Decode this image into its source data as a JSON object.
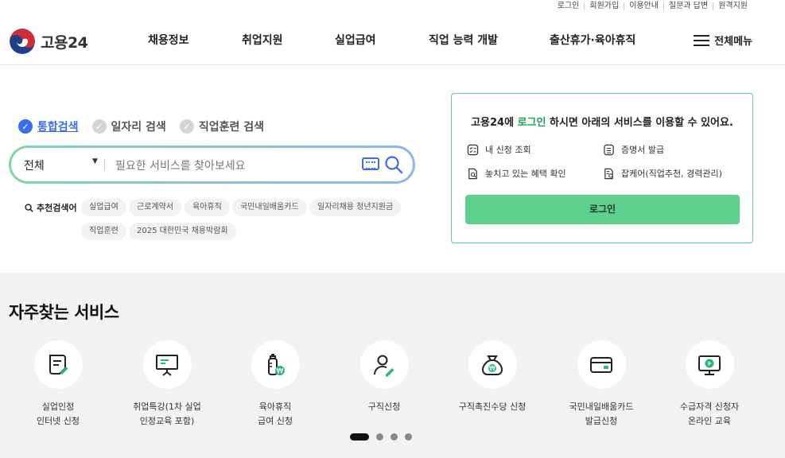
{
  "util_links": [
    "로그인",
    "회원가입",
    "이용안내",
    "질문과 답변",
    "원격지원"
  ],
  "logo": {
    "text": "고용24"
  },
  "nav": [
    "채용정보",
    "취업지원",
    "실업급여",
    "직업 능력 개발",
    "출산휴가·육아휴직"
  ],
  "all_menu": "전체메뉴",
  "search": {
    "tabs": [
      "통합검색",
      "일자리 검색",
      "직업훈련 검색"
    ],
    "active_tab": 0,
    "category": "전체",
    "placeholder": "필요한 서비스를 찾아보세요",
    "recommend_label": "추천검색어",
    "chips": [
      "실업급여",
      "근로계약서",
      "육아휴직",
      "국민내일배움카드",
      "일자리채용 청년지원금",
      "직업훈련",
      "2025 대한민국 채용박람회"
    ]
  },
  "login_box": {
    "title_pre": "고용24에",
    "title_link": "로그인",
    "title_post": "하시면 아래의 서비스를 이용할 수 있어요.",
    "services": [
      "내 신청 조회",
      "증명서 발급",
      "놓치고 있는 혜택 확인",
      "잡케어(직업추천, 경력관리)"
    ],
    "button": "로그인"
  },
  "frequent": {
    "title": "자주찾는 서비스",
    "items": [
      {
        "label": "실업인정\n인터넷 신청",
        "icon": "document-pen-icon"
      },
      {
        "label": "취업특강(1차 실업\n인정교육 포함)",
        "icon": "presentation-board-icon"
      },
      {
        "label": "육아휴직\n급여 신청",
        "icon": "baby-bottle-won-icon"
      },
      {
        "label": "구직신청",
        "icon": "person-pen-icon"
      },
      {
        "label": "구직촉진수당 신청",
        "icon": "money-bag-won-icon"
      },
      {
        "label": "국민내일배움카드\n발급신청",
        "icon": "credit-card-icon"
      },
      {
        "label": "수급자격 신청자\n온라인 교육",
        "icon": "monitor-play-icon"
      }
    ],
    "page_count": 4,
    "active_page": 0
  },
  "colors": {
    "accent_green": "#5ed08e",
    "accent_blue": "#3d6ee8",
    "section_bg": "#f2f2f2"
  }
}
